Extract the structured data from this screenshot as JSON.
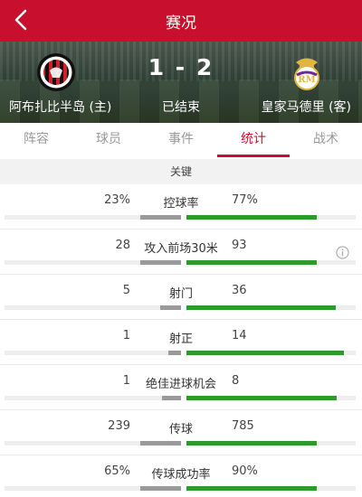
{
  "nav": {
    "title": "赛况"
  },
  "match": {
    "home_team": "阿布扎比半岛 (主)",
    "away_team": "皇家马德里 (客)",
    "score": "1 - 2",
    "status": "已结束",
    "home_logo_text": "AL JAZIRA CLUB"
  },
  "tabs": [
    {
      "label": "阵容",
      "active": false
    },
    {
      "label": "球员",
      "active": false
    },
    {
      "label": "事件",
      "active": false
    },
    {
      "label": "统计",
      "active": true
    },
    {
      "label": "战术",
      "active": false
    }
  ],
  "section": {
    "title": "关键"
  },
  "stats": [
    {
      "label": "控球率",
      "home": "23%",
      "away": "77%",
      "home_fraction": 0.23,
      "away_fraction": 0.77,
      "info_icon": false
    },
    {
      "label": "攻入前场30米",
      "home": "28",
      "away": "93",
      "home_fraction": 0.23,
      "away_fraction": 0.77,
      "info_icon": true
    },
    {
      "label": "射门",
      "home": "5",
      "away": "36",
      "home_fraction": 0.12,
      "away_fraction": 0.88,
      "info_icon": false
    },
    {
      "label": "射正",
      "home": "1",
      "away": "14",
      "home_fraction": 0.07,
      "away_fraction": 0.93,
      "info_icon": false
    },
    {
      "label": "绝佳进球机会",
      "home": "1",
      "away": "8",
      "home_fraction": 0.11,
      "away_fraction": 0.89,
      "info_icon": false
    },
    {
      "label": "传球",
      "home": "239",
      "away": "785",
      "home_fraction": 0.23,
      "away_fraction": 0.77,
      "info_icon": false
    },
    {
      "label": "传球成功率",
      "home": "65%",
      "away": "90%",
      "home_fraction": 0.23,
      "away_fraction": 0.77,
      "info_icon": false
    }
  ],
  "colors": {
    "brand_red": "#c8102e",
    "home_bar": "#9a9a9a",
    "away_bar": "#2e9a2e"
  }
}
